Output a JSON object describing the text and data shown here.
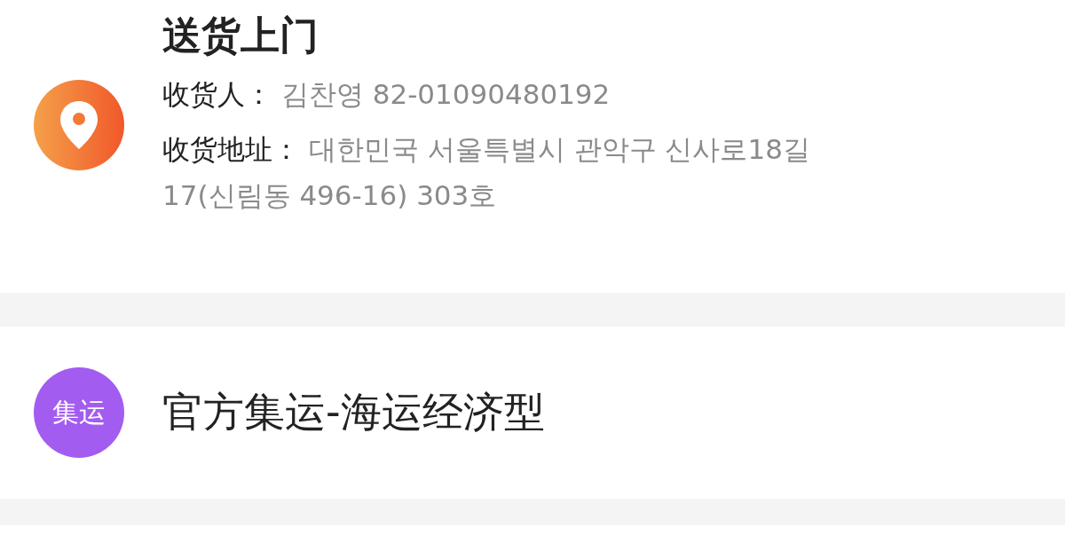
{
  "delivery": {
    "title": "送货上门",
    "recipient": {
      "label": "收货人：",
      "name": "김찬영",
      "phone": "82-01090480192"
    },
    "address": {
      "label": "收货地址：",
      "lines": [
        "대한민국 서울특별시 관악구 신사로18길",
        "17(신림동 496-16) 303호"
      ]
    }
  },
  "shipping": {
    "badge": "集运",
    "method": "官方集运-海运经济型"
  }
}
